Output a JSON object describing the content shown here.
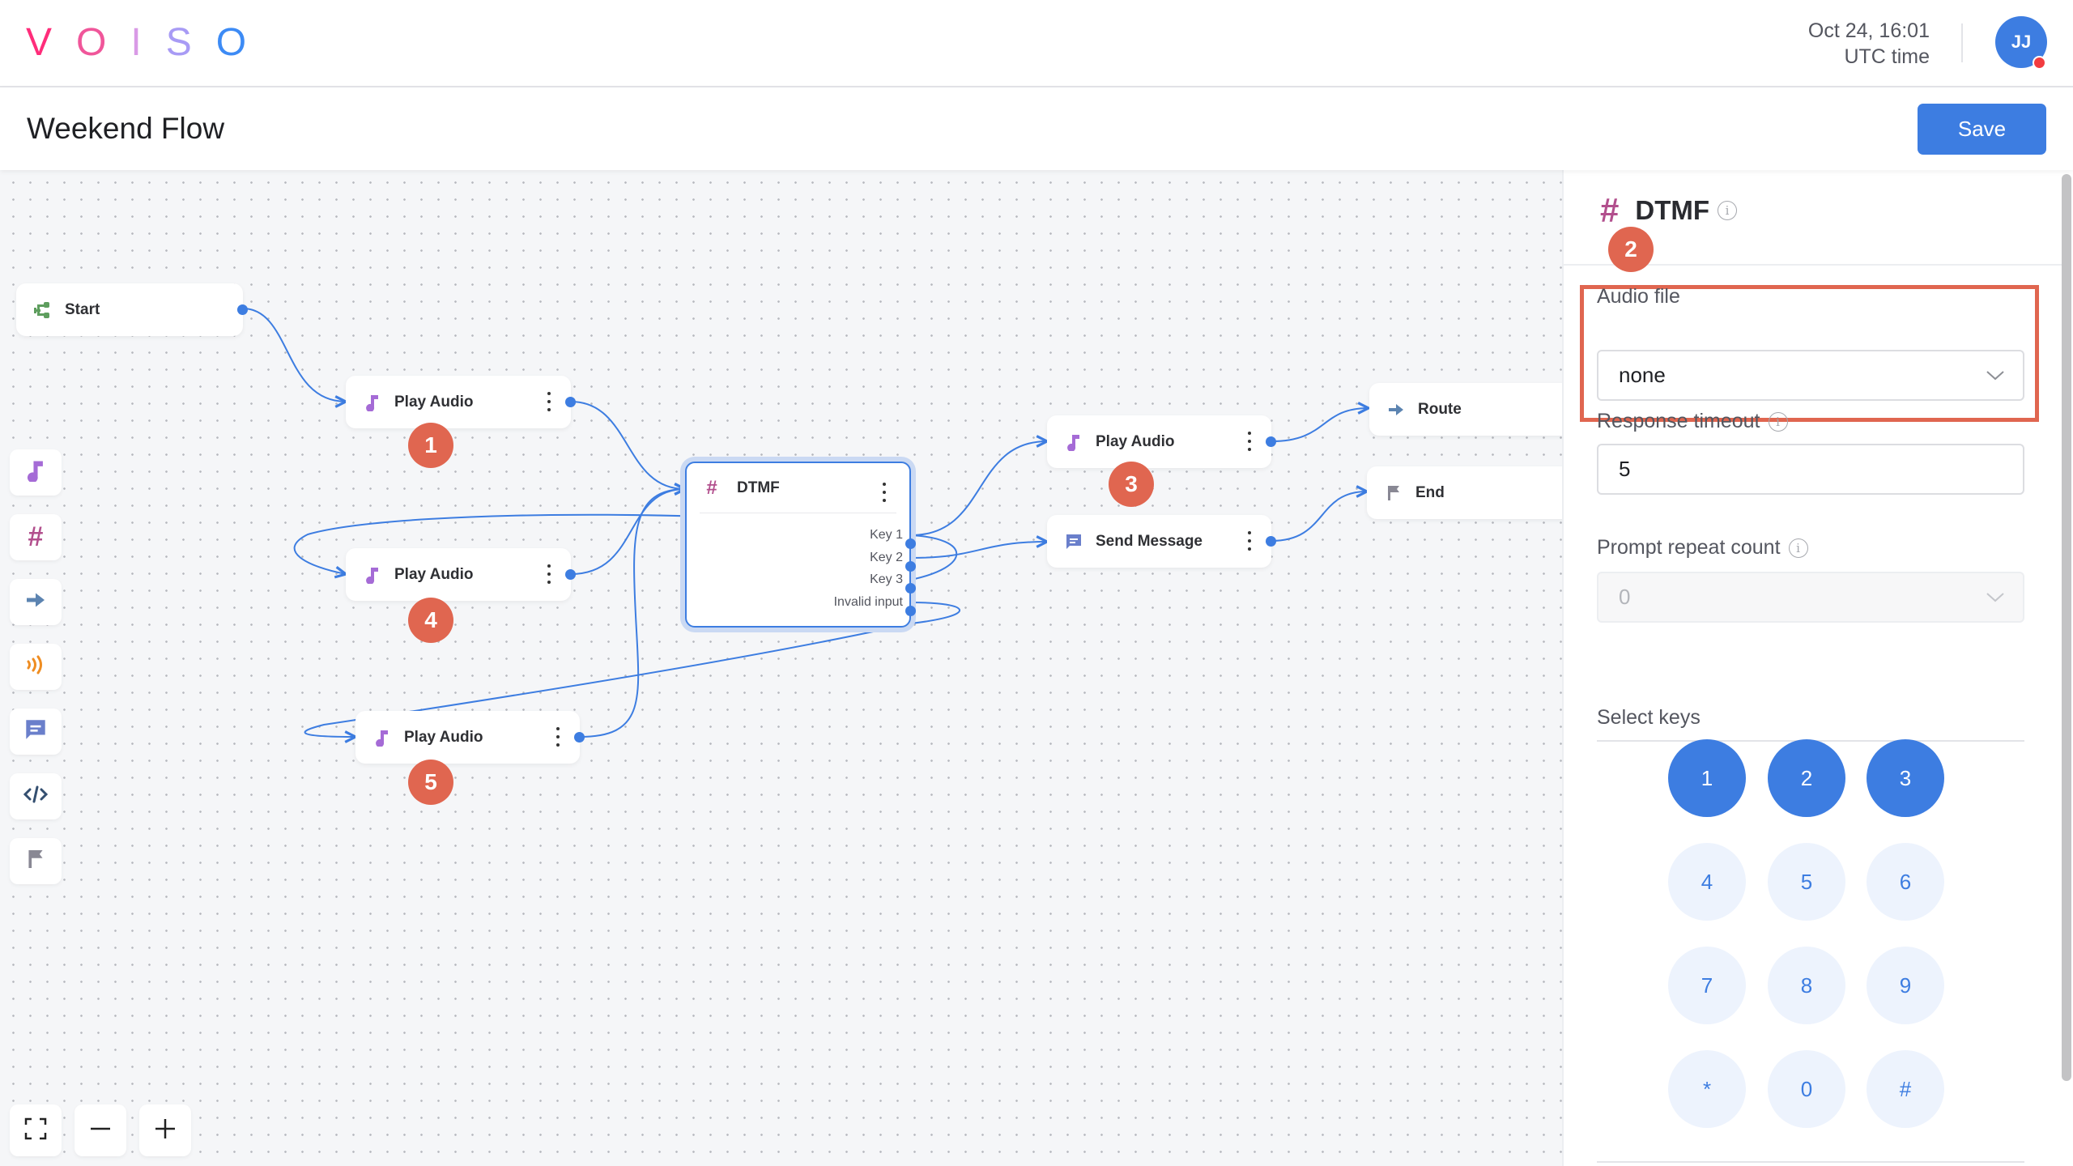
{
  "header": {
    "logo_letters": [
      {
        "char": "V",
        "color": "#ff2d7a"
      },
      {
        "char": "O",
        "color": "#f0569a"
      },
      {
        "char": "I",
        "color": "#d99ae6"
      },
      {
        "char": "S",
        "color": "#a89bf5"
      },
      {
        "char": "O",
        "color": "#3d8bf5"
      }
    ],
    "date": "Oct 24, 16:01",
    "timezone": "UTC time",
    "avatar_initials": "JJ",
    "avatar_color": "#3d7de1",
    "status_dot_color": "#f23c40"
  },
  "titlebar": {
    "title": "Weekend Flow",
    "save_label": "Save"
  },
  "toolbar": {
    "items": [
      {
        "name": "play-audio",
        "icon": "music-note-icon",
        "color": "#a56bd6"
      },
      {
        "name": "dtmf",
        "icon": "hash-icon",
        "color": "#b24f8d"
      },
      {
        "name": "route",
        "icon": "arrow-right-icon",
        "color": "#5c84b1"
      },
      {
        "name": "broadcast",
        "icon": "signal-waves-icon",
        "color": "#ef8d22"
      },
      {
        "name": "send-message",
        "icon": "message-icon",
        "color": "#6a7fcb"
      },
      {
        "name": "code",
        "icon": "code-icon",
        "color": "#344f70"
      },
      {
        "name": "end",
        "icon": "flag-icon",
        "color": "#898894"
      }
    ],
    "zoom_controls": [
      "fit-screen",
      "zoom-out",
      "zoom-in"
    ]
  },
  "flow": {
    "nodes": {
      "start": {
        "label": "Start",
        "icon": "start-branch-icon"
      },
      "play_audio_1": {
        "label": "Play Audio",
        "icon": "music-note-icon"
      },
      "play_audio_4": {
        "label": "Play Audio",
        "icon": "music-note-icon"
      },
      "play_audio_5": {
        "label": "Play Audio",
        "icon": "music-note-icon"
      },
      "dtmf": {
        "label": "DTMF",
        "icon": "hash-icon",
        "outputs": [
          "Key 1",
          "Key 2",
          "Key 3",
          "Invalid input"
        ]
      },
      "play_audio_3": {
        "label": "Play Audio",
        "icon": "music-note-icon"
      },
      "send_message": {
        "label": "Send Message",
        "icon": "message-icon"
      },
      "route": {
        "label": "Route",
        "icon": "arrow-right-icon"
      },
      "end": {
        "label": "End",
        "icon": "flag-icon"
      }
    },
    "edges": [
      {
        "from": "start",
        "to": "play_audio_1"
      },
      {
        "from": "play_audio_1",
        "to": "dtmf"
      },
      {
        "from": "play_audio_4",
        "to": "dtmf"
      },
      {
        "from": "play_audio_5",
        "to": "dtmf"
      },
      {
        "from": "dtmf:Key 1",
        "to": "play_audio_3"
      },
      {
        "from": "dtmf:Key 2",
        "to": "send_message"
      },
      {
        "from": "dtmf:Key 3",
        "to": "play_audio_4"
      },
      {
        "from": "dtmf:Invalid input",
        "to": "play_audio_5"
      },
      {
        "from": "play_audio_3",
        "to": "route"
      },
      {
        "from": "send_message",
        "to": "end"
      }
    ],
    "badges": [
      "1",
      "2",
      "3",
      "4",
      "5"
    ],
    "badge_color": "#e06650"
  },
  "panel": {
    "title": "DTMF",
    "audio_file_label": "Audio file",
    "audio_file_value": "none",
    "response_timeout_label": "Response timeout",
    "response_timeout_value": "5",
    "prompt_repeat_label": "Prompt repeat count",
    "prompt_repeat_value": "0",
    "select_keys_label": "Select keys",
    "keys": [
      {
        "label": "1",
        "selected": true
      },
      {
        "label": "2",
        "selected": true
      },
      {
        "label": "3",
        "selected": true
      },
      {
        "label": "4",
        "selected": false
      },
      {
        "label": "5",
        "selected": false
      },
      {
        "label": "6",
        "selected": false
      },
      {
        "label": "7",
        "selected": false
      },
      {
        "label": "8",
        "selected": false
      },
      {
        "label": "9",
        "selected": false
      },
      {
        "label": "*",
        "selected": false
      },
      {
        "label": "0",
        "selected": false
      },
      {
        "label": "#",
        "selected": false
      }
    ]
  }
}
